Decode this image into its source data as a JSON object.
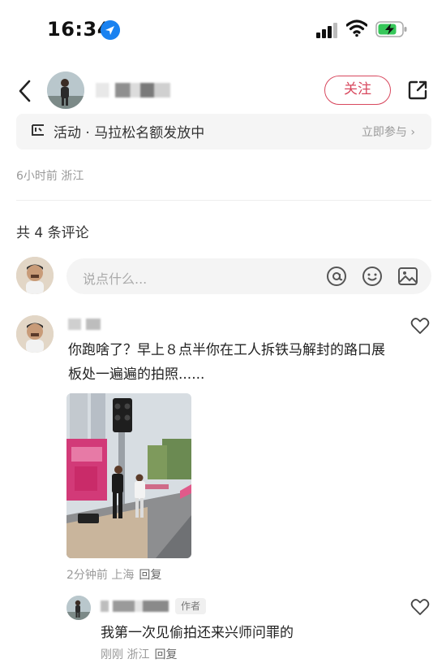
{
  "status_bar": {
    "time": "16:34"
  },
  "header": {
    "follow_label": "关注",
    "icons": [
      "back-arrow-icon",
      "share-icon"
    ]
  },
  "activity": {
    "text": "活动 · 马拉松名额发放中",
    "join_label": "立即参与 ›"
  },
  "post": {
    "meta": "6小时前 浙江"
  },
  "comments_section": {
    "count_label": "共 4 条评论",
    "input_placeholder": "说点什么..."
  },
  "comments": [
    {
      "text": "你跑啥了？早上８点半你在工人拆铁马解封的路口展板处一遍遍的拍照......",
      "meta_time_location": "2分钟前 上海",
      "reply_label": "回复",
      "has_photo": true
    }
  ],
  "reply": {
    "author_badge": "作者",
    "text": "我第一次见偷拍还来兴师问罪的",
    "meta_time_location": "刚刚 浙江",
    "reply_label": "回复"
  },
  "colors": {
    "accent": "#d8485e",
    "muted_text": "#999999",
    "input_bg": "#f4f4f4"
  }
}
